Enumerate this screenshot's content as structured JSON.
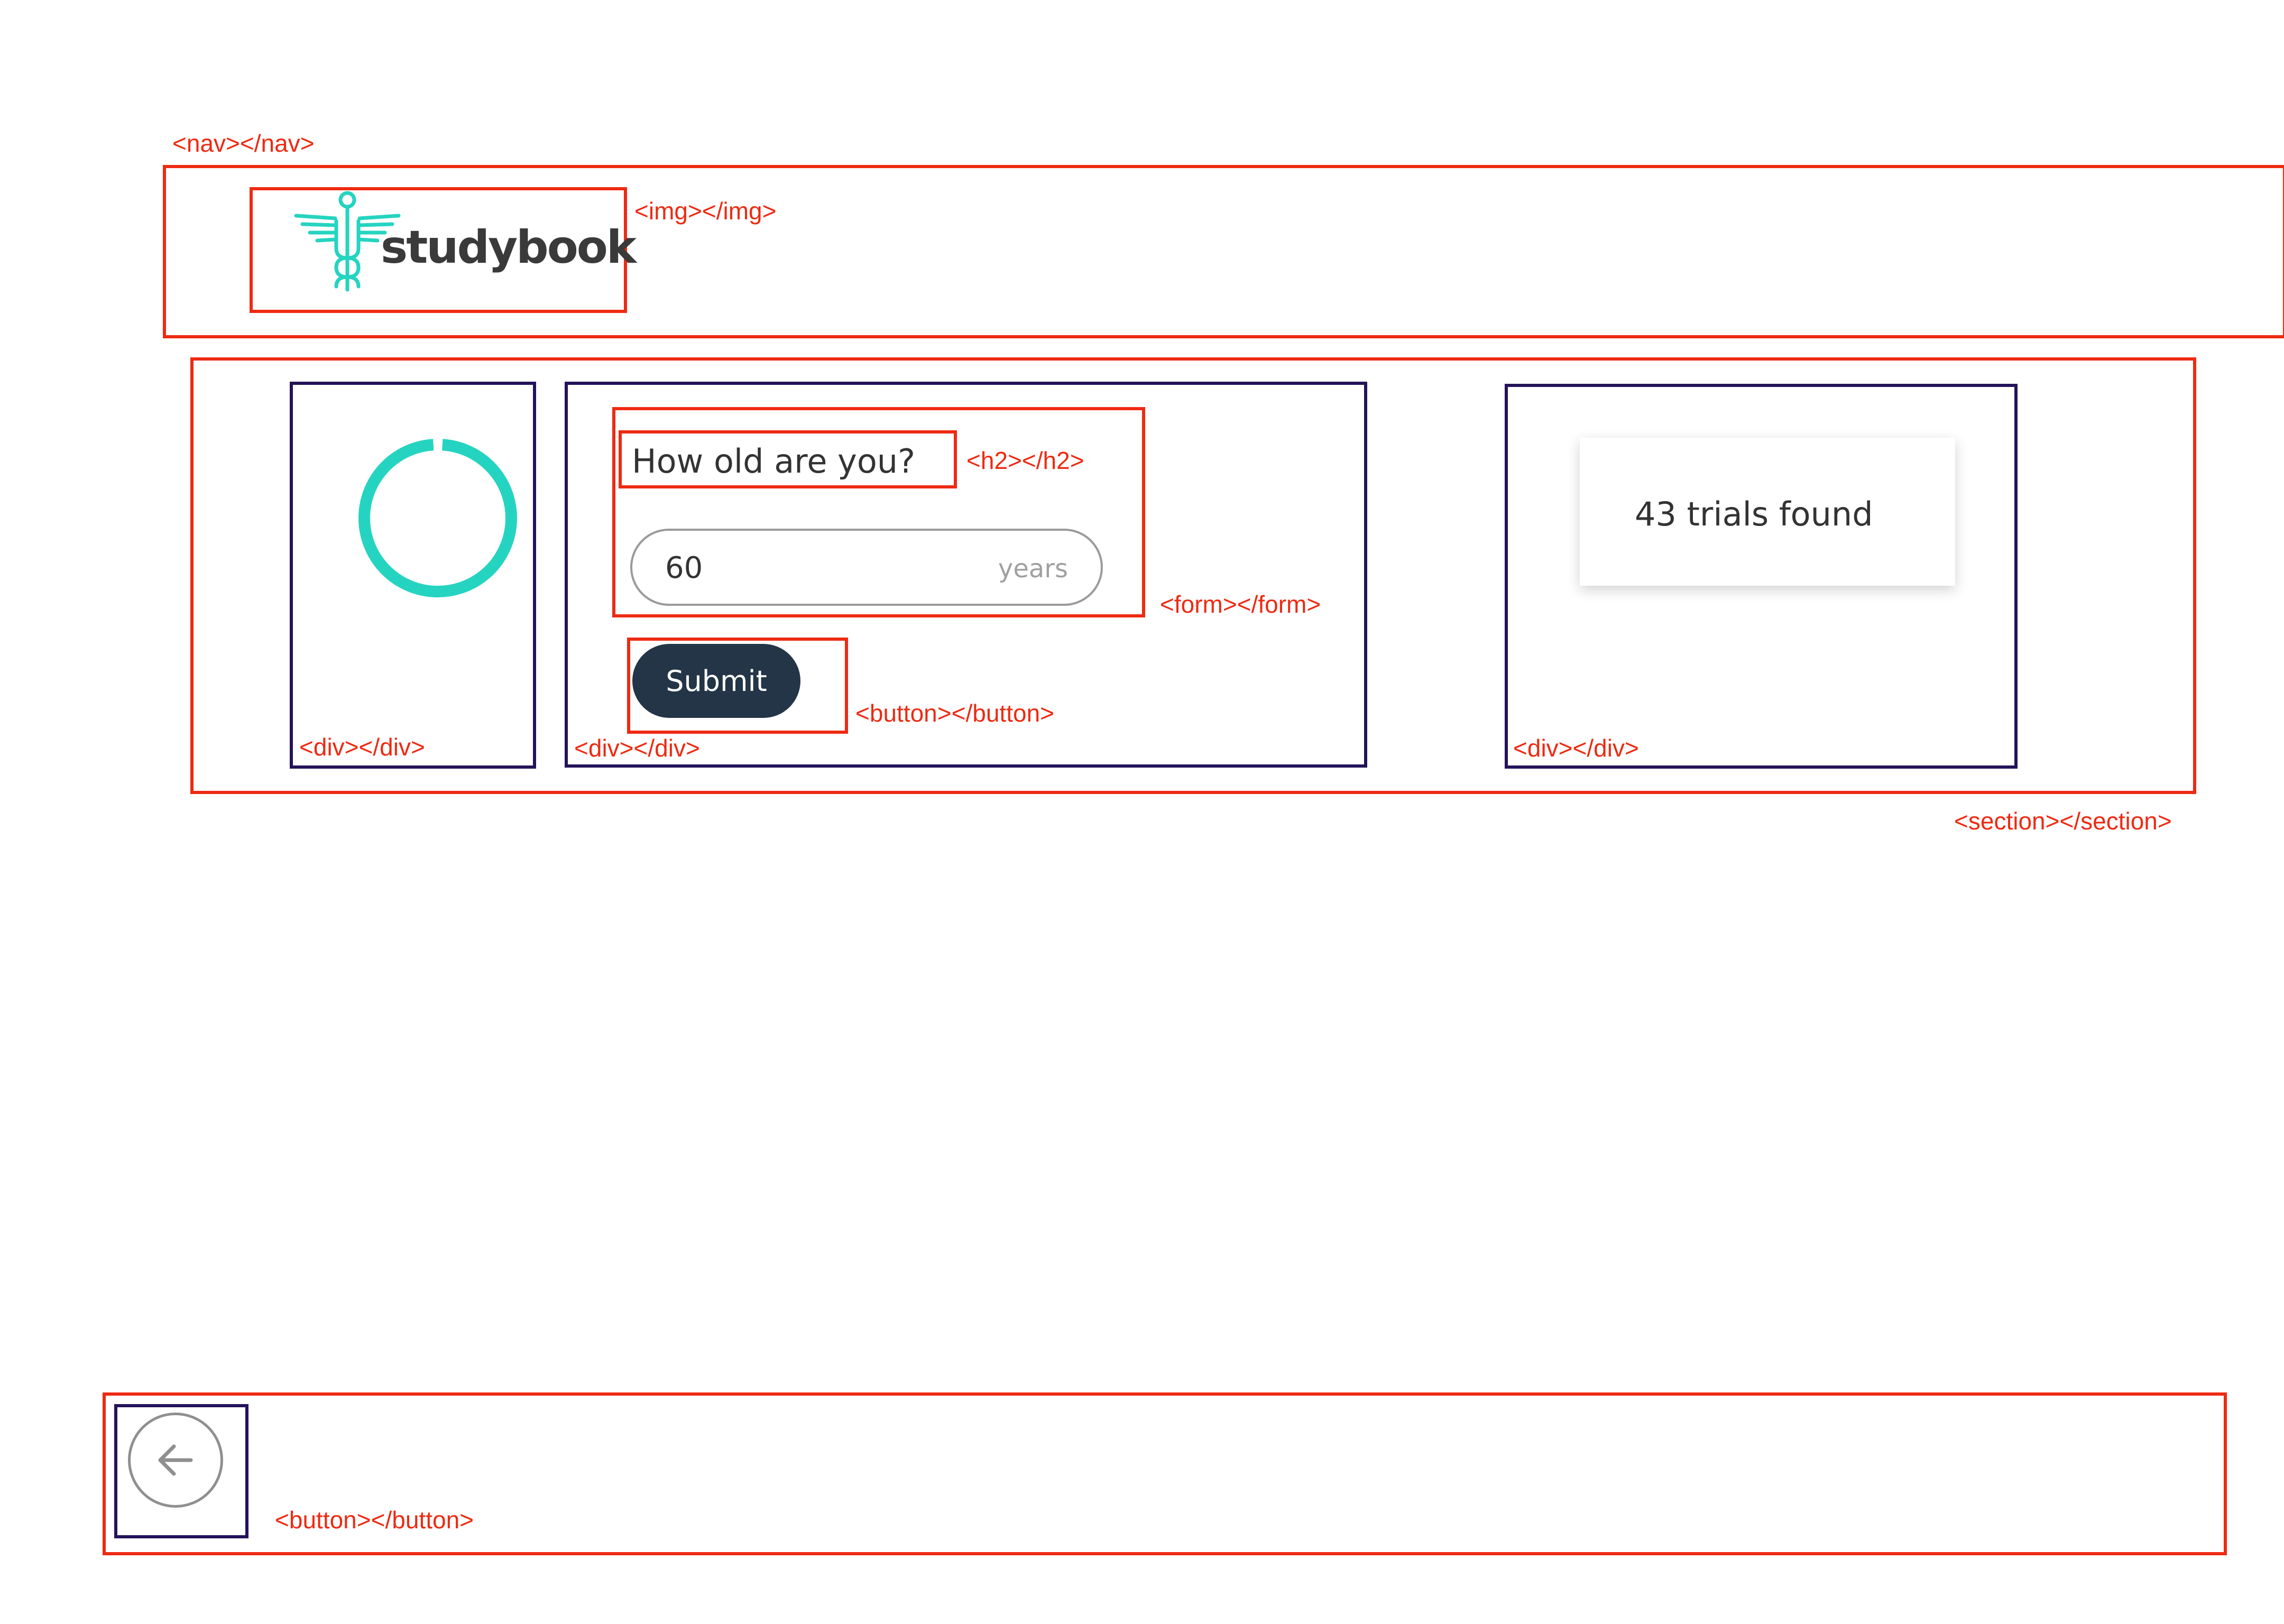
{
  "nav": {
    "tag": "<nav></nav>",
    "logo": {
      "tag": "<img></img>",
      "text": "studybook",
      "icon": "caduceus-icon",
      "color": "#25d4c0"
    }
  },
  "section": {
    "tag": "<section></section>",
    "progress": {
      "tag": "<div></div>",
      "value": 0.98,
      "color": "#25d4c0"
    },
    "question": {
      "tag": "<div></div>",
      "form_tag": "<form></form>",
      "heading_tag": "<h2></h2>",
      "heading": "How old are you?",
      "input_value": "60",
      "input_unit": "years",
      "button_tag": "<button></button>",
      "submit_label": "Submit"
    },
    "results": {
      "tag": "<div></div>",
      "text": "43 trials found"
    }
  },
  "footer": {
    "button_tag": "<button></button>",
    "back_icon": "arrow-left-icon"
  },
  "colors": {
    "annotation": "#ee2a12",
    "container": "#24135a",
    "button": "#233547"
  }
}
